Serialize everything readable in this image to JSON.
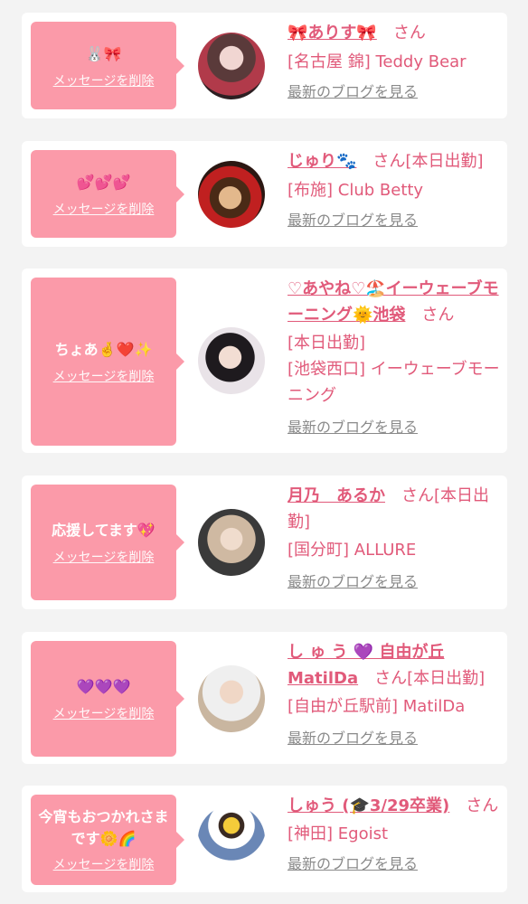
{
  "common": {
    "delete_label": "メッセージを削除",
    "san_suffix": "さん",
    "blog_label": "最新のブログを見る"
  },
  "cards": [
    {
      "message": "🐰🎀",
      "name": "🎀ありす🎀",
      "status": "",
      "shop": "[名古屋 錦] Teddy Bear"
    },
    {
      "message": "💕💕💕",
      "name": "じゅり🐾",
      "status": "[本日出勤]",
      "shop": "[布施] Club Betty"
    },
    {
      "message": "ちょあ🤞❤️✨",
      "name": "♡あやね♡🏖️イーウェーブモーニング🌞池袋",
      "status": "[本日出勤]",
      "shop": "[池袋西口] イーウェーブモーニング"
    },
    {
      "message": "応援してます💖",
      "name": "月乃　あるか",
      "status": "[本日出勤]",
      "shop": "[国分町] ALLURE"
    },
    {
      "message": "💜💜💜",
      "name": "し ゅ う 💜 自由が丘MatilDa",
      "status": "[本日出勤]",
      "shop": "[自由が丘駅前] MatilDa"
    },
    {
      "message": "今宵もおつかれさまです🌼🌈",
      "name": "しゅう (🎓3/29卒業)",
      "status": "",
      "shop": "[神田] Egoist"
    }
  ],
  "colors": {
    "bubble": "#fb9aa9",
    "accent": "#e15a7a",
    "background": "#f3f3f3"
  }
}
